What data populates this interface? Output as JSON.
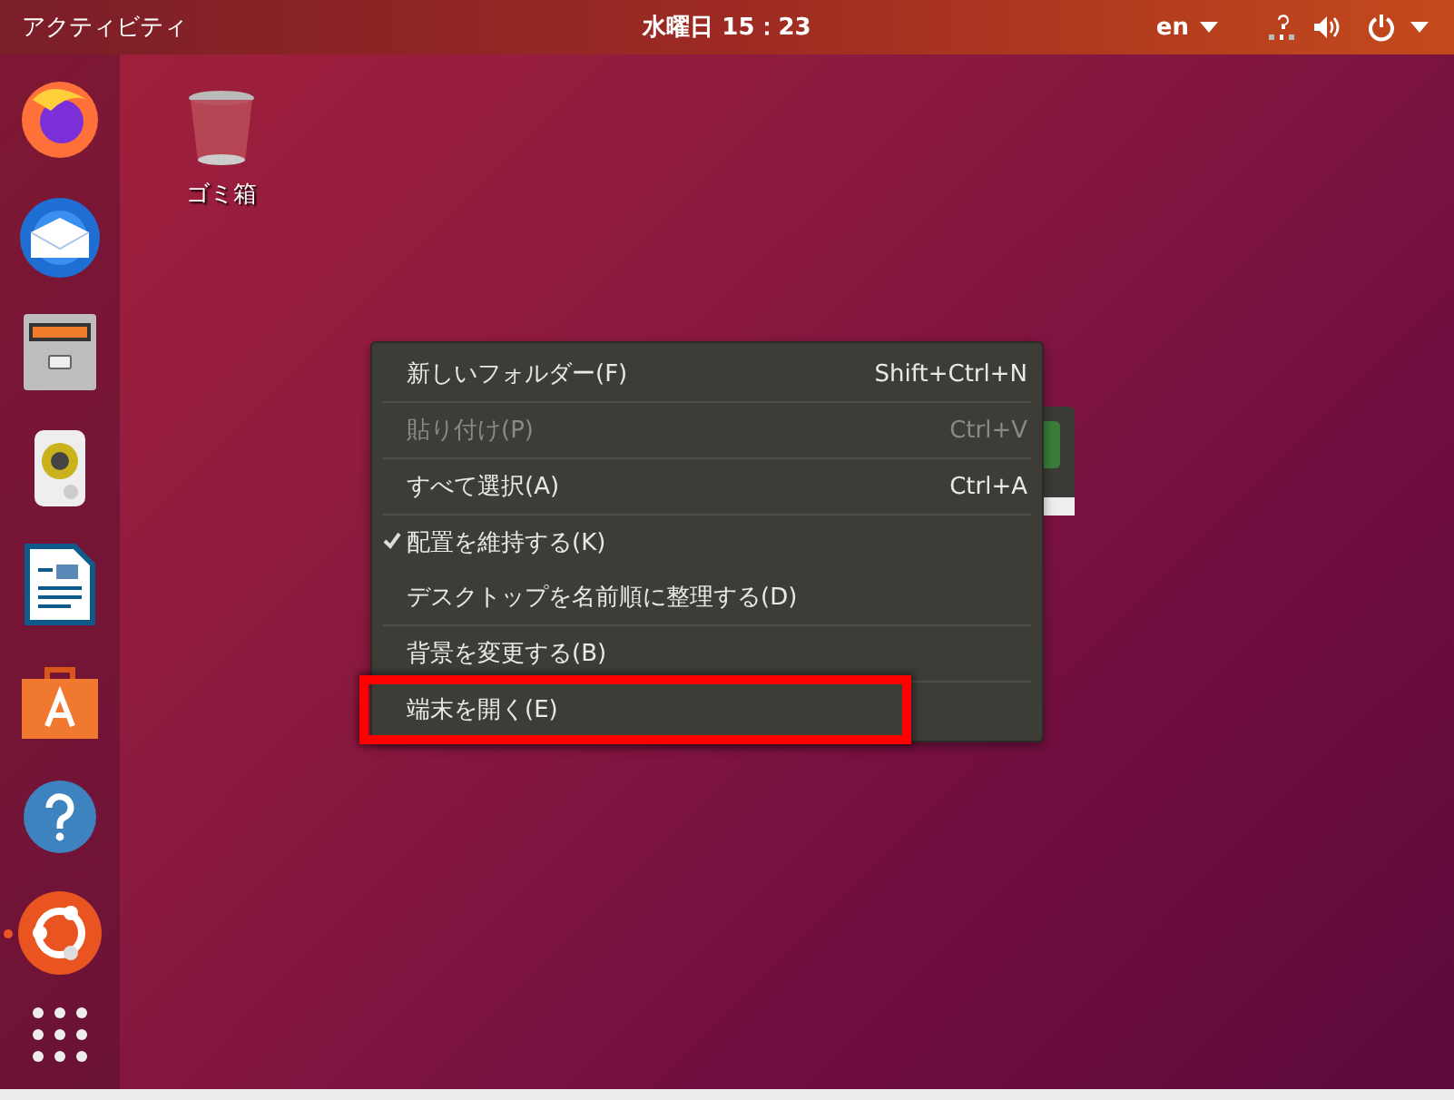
{
  "top_bar": {
    "activities": "アクティビティ",
    "clock": "水曜日 15：23",
    "input_source": "en"
  },
  "dock": {
    "items": [
      {
        "kind": "firefox",
        "running": false
      },
      {
        "kind": "mail",
        "running": false
      },
      {
        "kind": "files",
        "running": false
      },
      {
        "kind": "speaker",
        "running": false
      },
      {
        "kind": "writer",
        "running": false
      },
      {
        "kind": "store",
        "running": false
      },
      {
        "kind": "help",
        "running": false
      },
      {
        "kind": "ubuntu",
        "running": true
      }
    ]
  },
  "desktop_icons": [
    {
      "label": "ゴミ箱"
    }
  ],
  "context_menu": {
    "items": [
      {
        "kind": "item",
        "label": "新しいフォルダー(F)",
        "shortcut": "Shift+Ctrl+N",
        "disabled": false,
        "checked": false,
        "highlighted": false
      },
      {
        "kind": "separator"
      },
      {
        "kind": "item",
        "label": "貼り付け(P)",
        "shortcut": "Ctrl+V",
        "disabled": true,
        "checked": false,
        "highlighted": false
      },
      {
        "kind": "separator"
      },
      {
        "kind": "item",
        "label": "すべて選択(A)",
        "shortcut": "Ctrl+A",
        "disabled": false,
        "checked": false,
        "highlighted": false
      },
      {
        "kind": "separator"
      },
      {
        "kind": "item",
        "label": "配置を維持する(K)",
        "disabled": false,
        "checked": true,
        "highlighted": false
      },
      {
        "kind": "item",
        "label": "デスクトップを名前順に整理する(D)",
        "disabled": false,
        "checked": false,
        "highlighted": false
      },
      {
        "kind": "separator"
      },
      {
        "kind": "item",
        "label": "背景を変更する(B)",
        "disabled": false,
        "checked": false,
        "highlighted": false
      },
      {
        "kind": "separator"
      },
      {
        "kind": "item",
        "label": "端末を開く(E)",
        "disabled": false,
        "checked": false,
        "highlighted": true
      }
    ]
  }
}
